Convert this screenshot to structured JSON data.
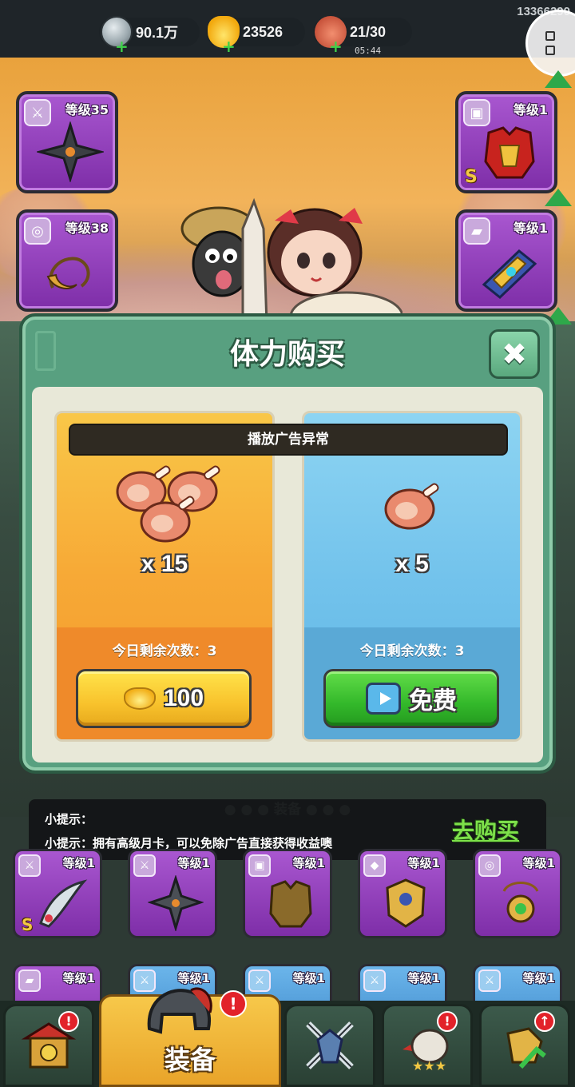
{
  "topbar": {
    "silver": "90.1万",
    "gold": "23526",
    "stamina": "21/30",
    "stamina_timer": "05:44",
    "uid": "13366290",
    "icons": {
      "silver": "silver-coin-icon",
      "gold": "gold-ingot-icon",
      "stamina": "meat-icon",
      "menu": "grid-menu-icon"
    }
  },
  "equip_slots": {
    "weapon": {
      "level": "等级35"
    },
    "accessory": {
      "level": "等级38"
    },
    "armor": {
      "level": "等级1",
      "grade": "S"
    },
    "boots": {
      "level": "等级1"
    }
  },
  "popup": {
    "title": "体力购买",
    "ad_error": "播放广告异常",
    "cards": [
      {
        "amount": "x 15",
        "remain": "今日剩余次数：3",
        "button_label": "100",
        "button_type": "gold"
      },
      {
        "amount": "x 5",
        "remain": "今日剩余次数：3",
        "button_label": "免费",
        "button_type": "ad"
      }
    ]
  },
  "section_label": "装备",
  "tip": {
    "line1": "小提示：",
    "line2": "小提示：拥有高级月卡，可以免除广告直接获得收益噢",
    "buy_label": "去购买"
  },
  "inventory": {
    "row1": [
      "等级1",
      "等级1",
      "等级1",
      "等级1",
      "等级1"
    ],
    "row2": [
      "等级1",
      "等级1",
      "等级1",
      "等级1",
      "等级1"
    ],
    "row1_grade": "S"
  },
  "nav": {
    "active_label": "装备",
    "badge": "!"
  },
  "colors": {
    "popup_bg": "#58a080",
    "orange_card": "#f7a936",
    "blue_card": "#73c3ec",
    "gold_button": "#f8c22c",
    "green_button": "#33b82a",
    "tip_link": "#7de04a"
  }
}
